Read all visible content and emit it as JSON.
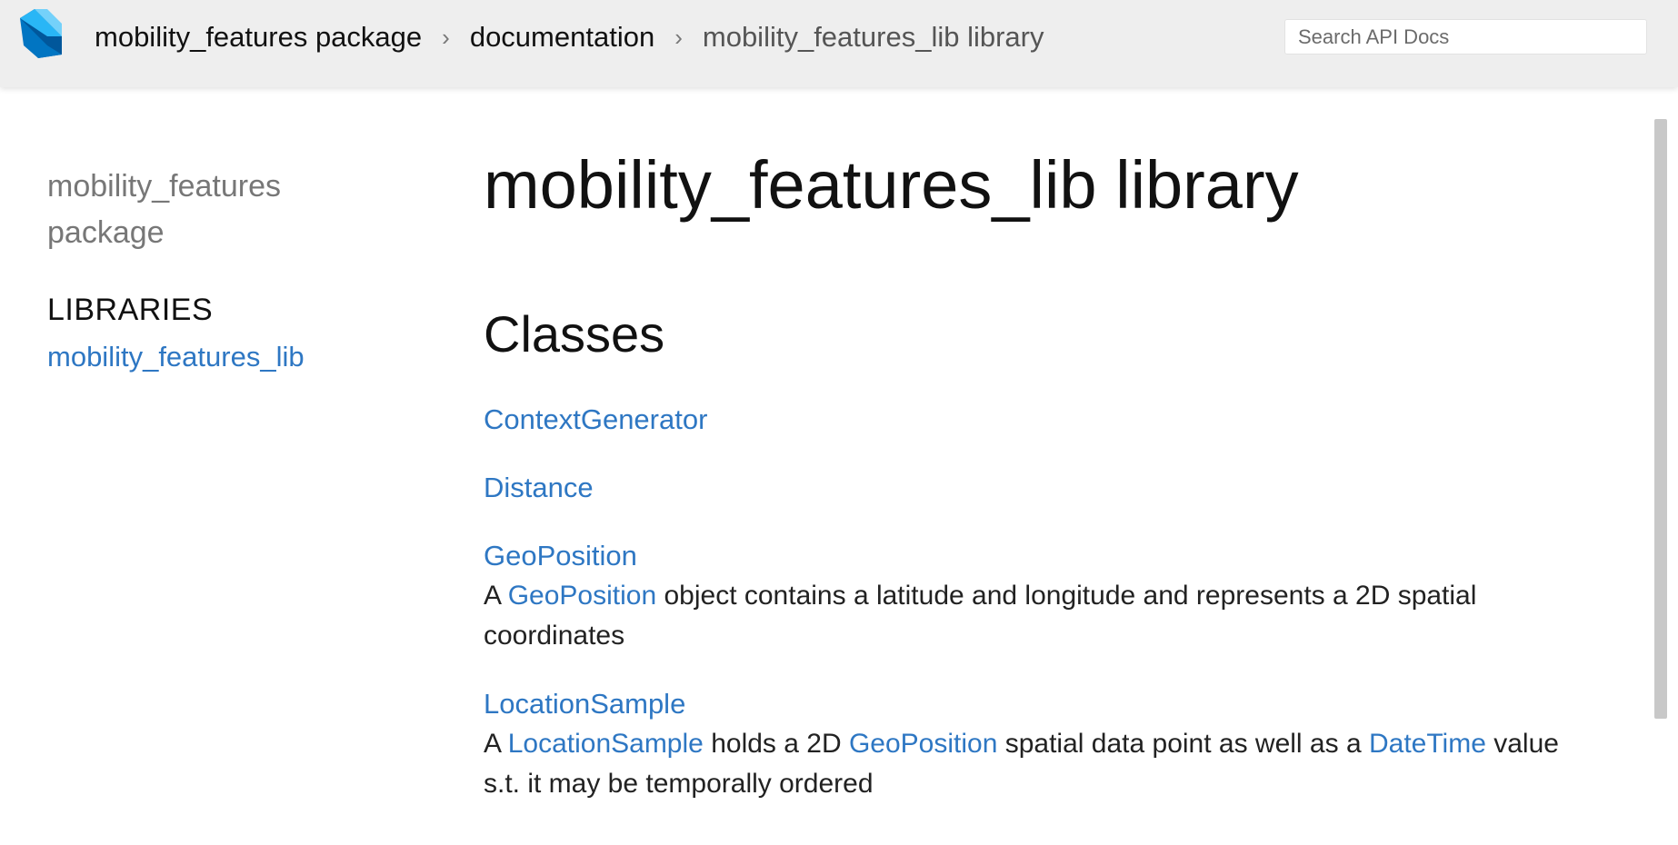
{
  "header": {
    "breadcrumbs": [
      "mobility_features package",
      "documentation",
      "mobility_features_lib library"
    ],
    "search_placeholder": "Search API Docs"
  },
  "sidebar": {
    "package_name_line1": "mobility_features",
    "package_name_line2": "package",
    "libraries_heading": "LIBRARIES",
    "libraries": [
      "mobility_features_lib"
    ]
  },
  "main": {
    "title": "mobility_features_lib library",
    "section_title": "Classes",
    "classes": [
      {
        "name": "ContextGenerator"
      },
      {
        "name": "Distance"
      },
      {
        "name": "GeoPosition",
        "desc": {
          "t0": "A ",
          "l1": "GeoPosition",
          "t1": " object contains a latitude and longitude and represents a 2D spatial coordinates"
        }
      },
      {
        "name": "LocationSample",
        "desc": {
          "t0": "A ",
          "l1": "LocationSample",
          "t1": " holds a 2D ",
          "l2": "GeoPosition",
          "t2": " spatial data point as well as a ",
          "l3": "DateTime",
          "t3": " value s.t. it may be temporally ordered"
        }
      }
    ]
  },
  "colors": {
    "link": "#2e77c3",
    "topbar": "#eeeeee",
    "text": "#111111"
  },
  "icons": [
    "dart-logo-icon"
  ]
}
